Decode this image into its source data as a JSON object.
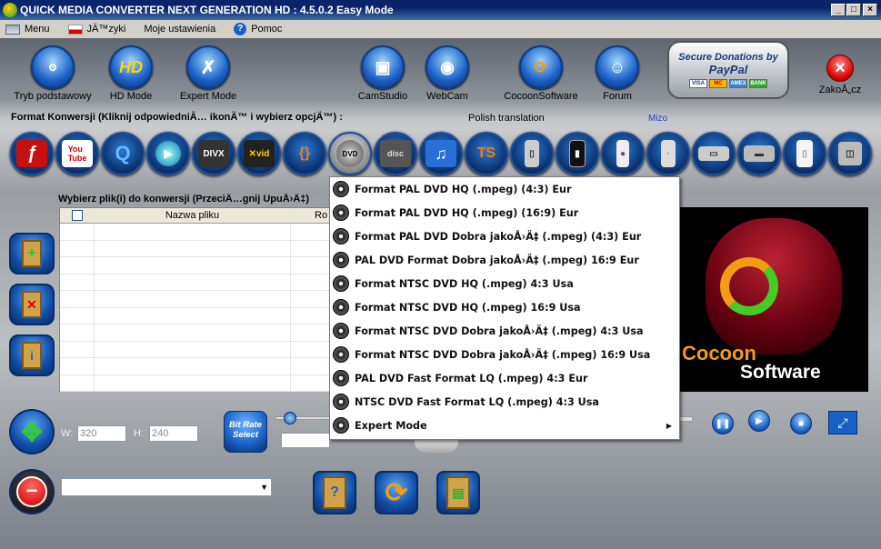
{
  "window": {
    "title": "QUICK MEDIA CONVERTER NEXT GENERATION HD : 4.5.0.2 Easy Mode"
  },
  "menubar": {
    "items": [
      {
        "label": "Menu"
      },
      {
        "label": "JÄ™zyki"
      },
      {
        "label": "Moje ustawienia"
      },
      {
        "label": "Pomoc"
      }
    ]
  },
  "toolbar": {
    "buttons": [
      {
        "label": "Tryb podstawowy",
        "icon": "basic-mode-icon"
      },
      {
        "label": "HD Mode",
        "icon": "hd-icon"
      },
      {
        "label": "Expert Mode",
        "icon": "tools-icon"
      },
      {
        "label": "CamStudio",
        "icon": "camstudio-icon"
      },
      {
        "label": "WebCam",
        "icon": "webcam-icon"
      },
      {
        "label": "CocoonSoftware",
        "icon": "cocoon-icon"
      },
      {
        "label": "Forum",
        "icon": "forum-icon"
      }
    ],
    "paypal": {
      "line1": "Secure Donations by",
      "line2": "PayPal",
      "cards": [
        "VISA",
        "MC",
        "AMEX",
        "BANK"
      ]
    },
    "close_label": "ZakoÅ„cz"
  },
  "format_section": {
    "label": "Format Konwersji (Kliknij odpowiedniÄ… ikonÄ™ i wybierz opcjÄ™) :",
    "translation": "Polish translation",
    "author": "Mizo"
  },
  "formats": [
    "Flash",
    "YouTube",
    "QuickTime",
    "Windows Media",
    "DivX",
    "Xvid",
    "Matroska",
    "DVD",
    "VCD",
    "Audio",
    "TS",
    "Nokia",
    "iPhone",
    "iPod",
    "Xbox 360",
    "PSP",
    "PS3",
    "Wii",
    "Nintendo DS"
  ],
  "file_list": {
    "label": "Wybierz plik(i) do konwersji (PrzeciÄ…gnij UpuÅ›Ä‡)",
    "col_name": "Nazwa pliku",
    "col_size": "Ro",
    "rows": 10
  },
  "dvd_menu": {
    "items": [
      "Format PAL DVD HQ (.mpeg) (4:3) Eur",
      "Format PAL DVD HQ (.mpeg) (16:9) Eur",
      "Format PAL DVD Dobra jakoÅ›Ä‡ (.mpeg) (4:3) Eur",
      "PAL DVD Format Dobra jakoÅ›Ä‡ (.mpeg) 16:9 Eur",
      "Format NTSC DVD HQ (.mpeg) 4:3 Usa",
      "Format NTSC DVD HQ (.mpeg) 16:9 Usa",
      "Format NTSC DVD Dobra jakoÅ›Ä‡ (.mpeg) 4:3 Usa",
      "Format NTSC DVD Dobra jakoÅ›Ä‡ (.mpeg) 16:9 Usa",
      "PAL DVD Fast Format LQ (.mpeg) 4:3 Eur",
      "NTSC DVD Fast Format LQ (.mpeg) 4:3 Usa",
      "Expert Mode"
    ]
  },
  "preview": {
    "brand1": "Cocoon",
    "brand2": "Software"
  },
  "size": {
    "w_label": "W:",
    "w_value": "320",
    "h_label": "H:",
    "h_value": "240",
    "bitrate_label": "Bit Rate Select"
  },
  "colors": {
    "accent": "#1a5fc4",
    "title": "#0a246a",
    "brand": "#f39c12"
  }
}
